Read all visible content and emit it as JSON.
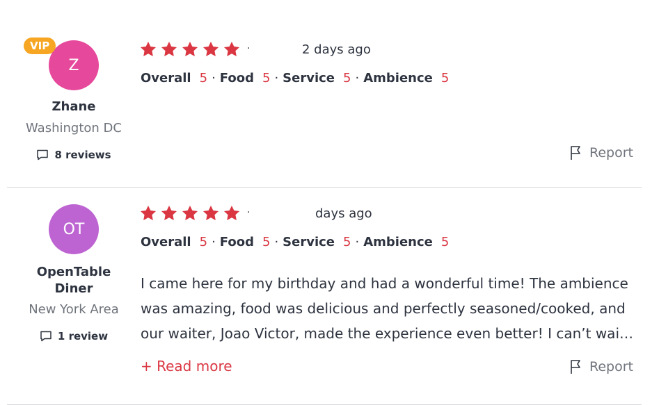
{
  "reviews": [
    {
      "user": {
        "vip_badge": "VIP",
        "initials": "Z",
        "avatar_color": "#e6489b",
        "name": "Zhane",
        "location": "Washington DC",
        "review_count": "8 reviews"
      },
      "stars": 5,
      "dot": "·",
      "date": "2 days ago",
      "ratings": [
        {
          "label": "Overall",
          "value": "5"
        },
        {
          "label": "Food",
          "value": "5"
        },
        {
          "label": "Service",
          "value": "5"
        },
        {
          "label": "Ambience",
          "value": "5"
        }
      ],
      "report_label": "Report"
    },
    {
      "user": {
        "initials": "OT",
        "avatar_color": "#bd64d2",
        "name_line1": "OpenTable",
        "name_line2": "Diner",
        "location": "New York Area",
        "review_count": "1 review"
      },
      "stars": 5,
      "dot": "·",
      "date": "days ago",
      "ratings": [
        {
          "label": "Overall",
          "value": "5"
        },
        {
          "label": "Food",
          "value": "5"
        },
        {
          "label": "Service",
          "value": "5"
        },
        {
          "label": "Ambience",
          "value": "5"
        }
      ],
      "text_lines": [
        "I came here for my birthday and had a wonderful time! The ambience",
        "was amazing, food was delicious and perfectly seasoned/cooked, and",
        "our waiter, Joao Victor, made the experience even better! I can’t wai…"
      ],
      "read_more": "+ Read more",
      "report_label": "Report"
    }
  ],
  "colors": {
    "accent": "#da3743",
    "star": "#da3743",
    "vip": "#f6a623",
    "divider": "#d8d9db"
  }
}
